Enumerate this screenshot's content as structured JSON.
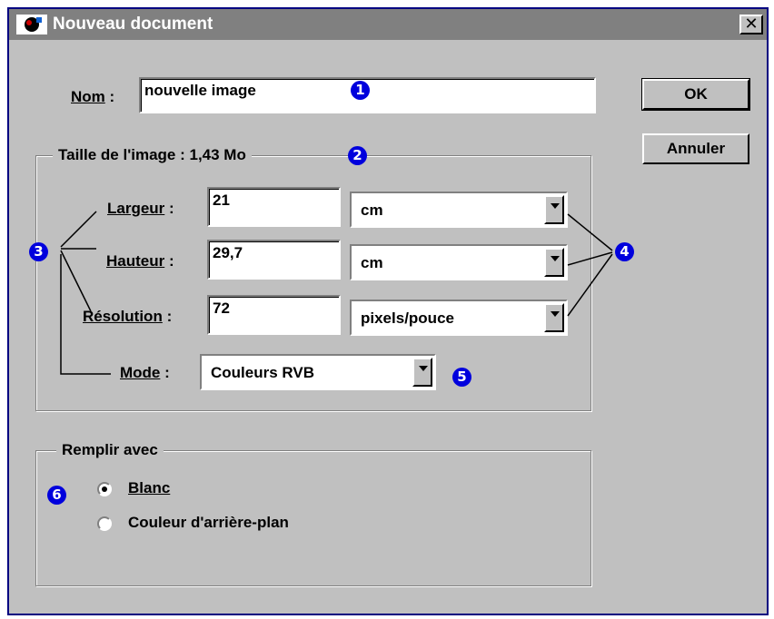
{
  "window": {
    "title": "Nouveau document",
    "close_glyph": "✕"
  },
  "name_field": {
    "label": "Nom",
    "value": "nouvelle image"
  },
  "buttons": {
    "ok": "OK",
    "cancel": "Annuler"
  },
  "image_size": {
    "legend": "Taille de l'image : 1,43 Mo",
    "width": {
      "label": "Largeur",
      "value": "21",
      "unit": "cm"
    },
    "height": {
      "label": "Hauteur",
      "value": "29,7",
      "unit": "cm"
    },
    "resolution": {
      "label": "Résolution",
      "value": "72",
      "unit": "pixels/pouce"
    },
    "mode": {
      "label": "Mode",
      "value": "Couleurs RVB"
    }
  },
  "fill": {
    "legend": "Remplir avec",
    "options": [
      {
        "label": "Blanc",
        "selected": true
      },
      {
        "label": "Couleur d'arrière-plan",
        "selected": false
      }
    ]
  },
  "callouts": [
    "1",
    "2",
    "3",
    "4",
    "5",
    "6"
  ],
  "colors": {
    "title_bar": "#808080",
    "dialog": "#c0c0c0",
    "callout": "#0000dd",
    "frame": "#000080"
  },
  "icons": {
    "app": "photo-app-icon",
    "close": "close-icon",
    "dropdown": "chevron-down-icon"
  }
}
